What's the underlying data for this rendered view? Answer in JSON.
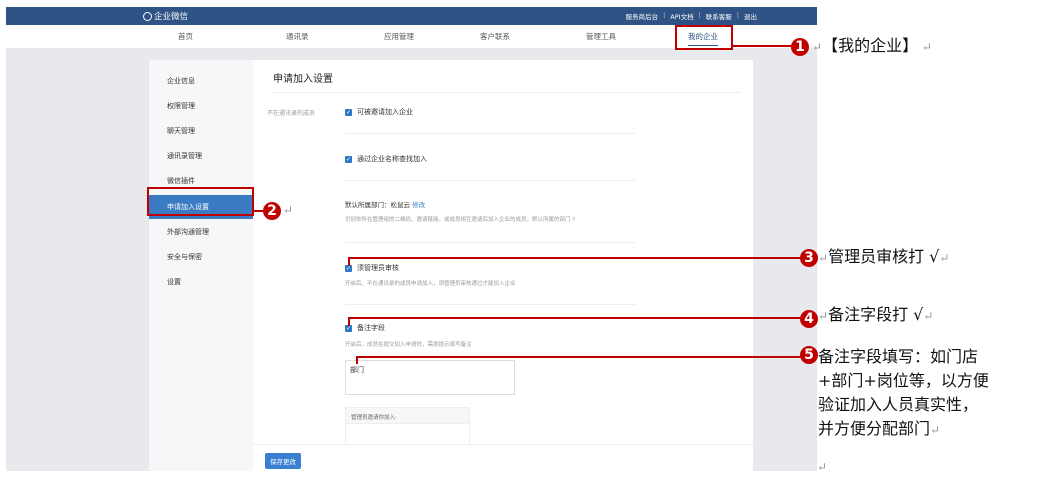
{
  "topbar": {
    "logo": "企业微信",
    "links": [
      "服务商后台",
      "API文档",
      "联系客服",
      "退出"
    ]
  },
  "nav": [
    "首页",
    "通讯录",
    "应用管理",
    "客户联系",
    "管理工具",
    "我的企业"
  ],
  "sidebar": [
    "企业信息",
    "权限管理",
    "聊天管理",
    "通讯录管理",
    "微信插件",
    "申请加入设置",
    "外部沟通管理",
    "安全与保密",
    "设置"
  ],
  "content": {
    "title": "申请加入设置",
    "row_label": "不在通讯录的成员",
    "opt1": "可被邀请加入企业",
    "opt2": "通过企业名称查找加入",
    "dept_label": "默认所属部门：松鼠云",
    "dept_edit": "修改",
    "dept_desc": "识别你所在管理组的二维码、邀请链接，或成员相互邀请后加入企业的成员，默认所属的部门",
    "opt3": "须管理员审核",
    "opt3_desc": "开启后，不在通讯录的成员申请加入，须管理员审核通过才能加入企业",
    "opt4": "备注字段",
    "opt4_desc": "开启后，成员在提交加入申请时，需按提示填写备注",
    "note_value": "部门",
    "preview_label": "管理员邀请你加入:",
    "save": "保存更改"
  },
  "annotations": {
    "n1": "1",
    "a1": "【我的企业】",
    "n2": "2",
    "n3": "3",
    "a3": "管理员审核打 √",
    "n4": "4",
    "a4": "备注字段打 √",
    "n5": "5",
    "a5": [
      "备注字段填写：如门店",
      "+部门+岗位等，以方便",
      "验证加入人员真实性，",
      "并方便分配部门"
    ]
  },
  "colors": {
    "topbar": "#2e5384",
    "accent": "#3b7bc4",
    "annotation": "#c00000"
  }
}
